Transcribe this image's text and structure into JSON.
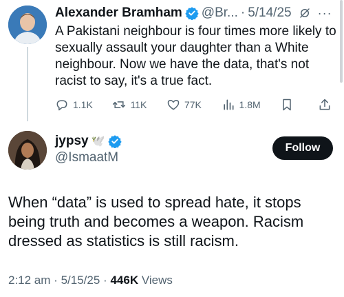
{
  "parent_tweet": {
    "author_name": "Alexander Bramham",
    "handle": "@Br...",
    "separator": "·",
    "date": "5/14/25",
    "more_label": "···",
    "text": "A Pakistani neighbour is four times more likely to sexually assault your daughter than a White neighbour. Now we have the data, that's not racist to say, it's a true fact.",
    "actions": {
      "replies": "1.1K",
      "reposts": "11K",
      "likes": "77K",
      "views": "1.8M"
    }
  },
  "reply_tweet": {
    "author_name": "jypsy",
    "handle": "@IsmaatM",
    "follow_label": "Follow",
    "text": "When “data” is used to spread hate, it stops being truth and becomes a weapon. Racism dressed as statistics is still racism.",
    "time": "2:12 am",
    "separator": "·",
    "date": "5/15/25",
    "views_count": "446K",
    "views_label": "Views"
  },
  "colors": {
    "verified_blue": "#1d9bf0",
    "muted_text": "#536471",
    "main_text": "#0f1419"
  },
  "icons": [
    "verified-icon",
    "grok-icon",
    "more-icon",
    "reply-icon",
    "repost-icon",
    "like-icon",
    "views-icon",
    "bookmark-icon",
    "share-icon",
    "dove-emoji"
  ]
}
